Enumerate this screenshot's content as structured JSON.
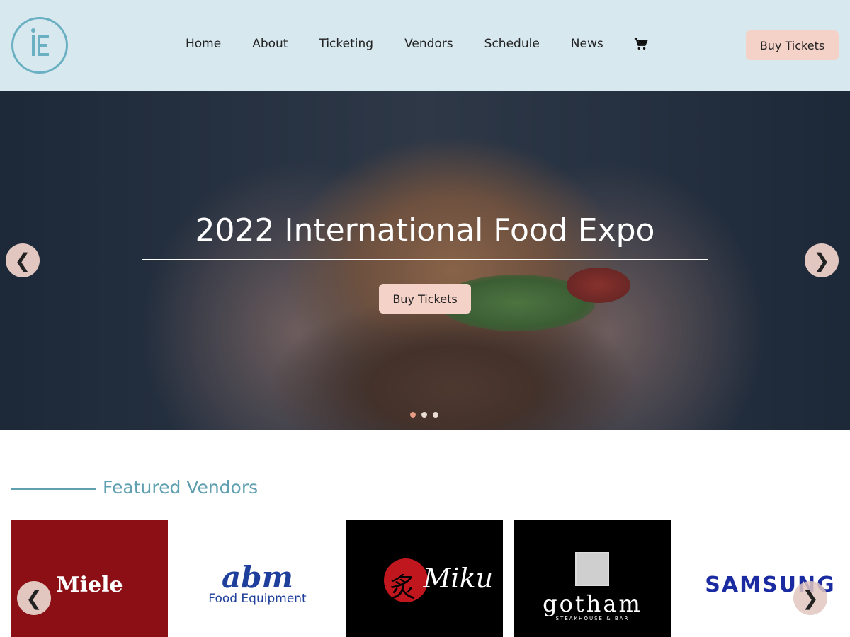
{
  "header": {
    "logo_letters": "iE",
    "nav": [
      "Home",
      "About",
      "Ticketing",
      "Vendors",
      "Schedule",
      "News"
    ],
    "cart_icon": "cart-icon",
    "buy_tickets_label": "Buy Tickets"
  },
  "hero": {
    "title": "2022 International Food Expo",
    "buy_tickets_label": "Buy Tickets",
    "prev_glyph": "❮",
    "next_glyph": "❯",
    "slides_count": 3,
    "active_slide": 1
  },
  "featured": {
    "title": "Featured Vendors",
    "vendors": [
      {
        "name": "Miele",
        "text": "Miele"
      },
      {
        "name": "abm Food Equipment",
        "text": "abm",
        "sub": "Food Equipment"
      },
      {
        "name": "Miku",
        "text": "Miku",
        "kanji": "炙"
      },
      {
        "name": "gotham",
        "text": "gotham",
        "sub": "STEAKHOUSE & BAR"
      },
      {
        "name": "Samsung",
        "text": "SAMSUNG"
      }
    ],
    "prev_glyph": "❮",
    "next_glyph": "❯"
  },
  "colors": {
    "header_bg": "#d7e8ef",
    "button_bg": "#f4d2c8",
    "accent_teal": "#5f9fb0",
    "dot_active": "#e99a84"
  }
}
